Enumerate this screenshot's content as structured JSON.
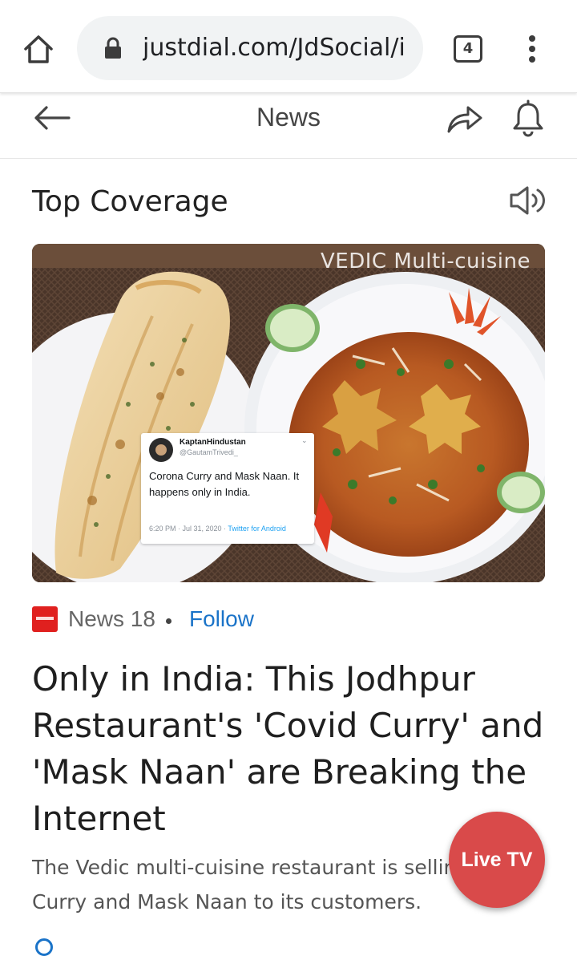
{
  "browser": {
    "url": "justdial.com/JdSocial/i",
    "tab_count": "4",
    "icons": [
      "home-icon",
      "lock-icon",
      "tabs-icon",
      "overflow-menu-icon"
    ]
  },
  "header": {
    "title": "News",
    "icons": [
      "back-arrow-icon",
      "share-icon",
      "bell-icon"
    ]
  },
  "section": {
    "title": "Top Coverage",
    "icon": "speaker-icon"
  },
  "hero": {
    "watermark": "VEDIC  Multi-cuisine",
    "tweet": {
      "name": "KaptanHindustan",
      "handle": "@GautamTrivedi_",
      "caret": "⌄",
      "text": "Corona Curry and Mask Naan. It happens only in India.",
      "time": "6:20 PM · Jul 31, 2020 ·",
      "source": "Twitter for Android"
    }
  },
  "article": {
    "source": "News 18",
    "follow": "Follow",
    "headline": "Only in India: This Jodhpur Restaurant's 'Covid Curry' and 'Mask Naan' are Breaking the Internet",
    "summary": "The Vedic multi-cuisine restaurant is selling Covid Curry and Mask Naan to its customers."
  },
  "live_tv": {
    "label": "Live TV"
  },
  "colors": {
    "accent_link": "#1a73c8",
    "live_tv": "#d94a4a",
    "source_logo": "#e0201f"
  }
}
